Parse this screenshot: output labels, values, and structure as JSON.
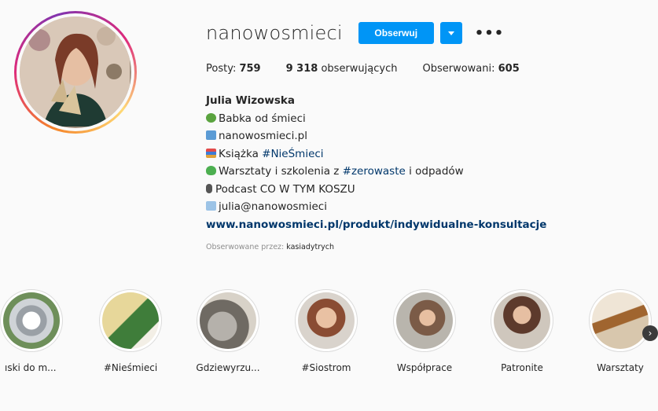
{
  "profile": {
    "username": "nanowosmieci",
    "follow_label": "Obserwuj",
    "more_label": "•••"
  },
  "stats": {
    "posts_label": "Posty: ",
    "posts_value": "759",
    "followers_value": "9 318",
    "followers_label": " obserwujących",
    "following_label": "Obserwowani: ",
    "following_value": "605"
  },
  "bio": {
    "name": "Julia Wizowska",
    "line1": "Babka od śmieci",
    "line2": "nanowosmieci.pl",
    "line3_prefix": "Książka ",
    "line3_tag": "#NieŚmieci",
    "line4_prefix": "Warsztaty i szkolenia z ",
    "line4_tag": "#zerowaste",
    "line4_suffix": " i odpadów",
    "line5": "Podcast CO W TYM KOSZU",
    "line6": "julia@nanowosmieci",
    "link": "www.nanowosmieci.pl/produkt/indywidualne-konsultacje",
    "followed_by_prefix": "Obserwowane przez: ",
    "followed_by_user": "kasiadytrych"
  },
  "highlights": [
    {
      "label": "ıski do m..."
    },
    {
      "label": "#Nieśmieci"
    },
    {
      "label": "Gdziewyrzu..."
    },
    {
      "label": "#Siostrom"
    },
    {
      "label": "Współprace"
    },
    {
      "label": "Patronite"
    },
    {
      "label": "Warsztaty"
    }
  ],
  "icons": {
    "recycle": "recycle-icon",
    "computer": "computer-icon",
    "books": "books-icon",
    "heart": "green-heart-icon",
    "mic": "microphone-icon",
    "mail": "envelope-icon"
  },
  "colors": {
    "accent": "#0095f6",
    "link": "#00376b"
  }
}
